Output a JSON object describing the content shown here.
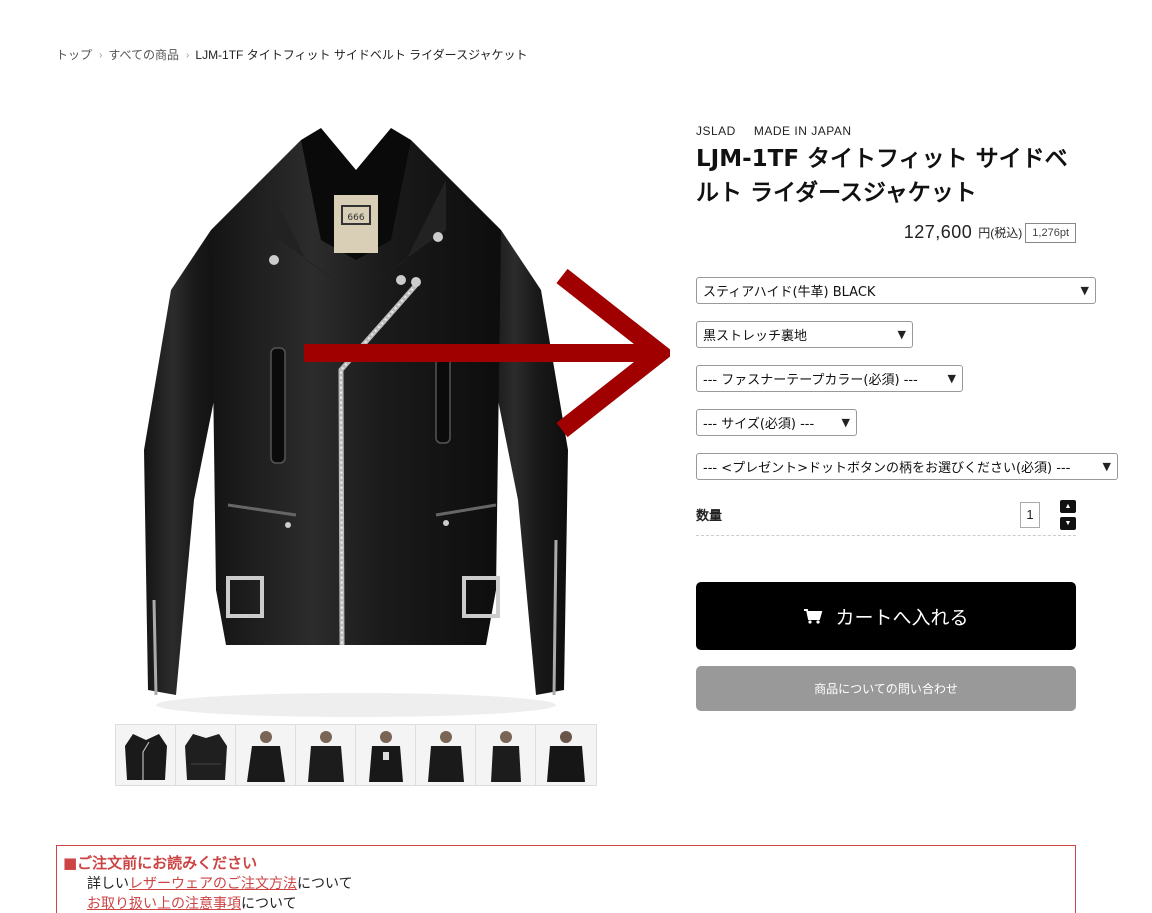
{
  "breadcrumb": {
    "items": [
      "トップ",
      "すべての商品"
    ],
    "current": "LJM-1TF タイトフィット サイドベルト ライダースジャケット",
    "separator": "›"
  },
  "product": {
    "brand": "JSLAD",
    "origin": "MADE IN JAPAN",
    "title": "LJM-1TF タイトフィット サイドベルト ライダースジャケット",
    "price": "127,600",
    "tax_label": "円(税込)",
    "points": "1,276pt"
  },
  "options": {
    "leather": "スティアハイド(牛革) BLACK",
    "lining": "黒ストレッチ裏地",
    "zipper_tape": "--- ファスナーテープカラー(必須) ---",
    "size": "--- サイズ(必須) ---",
    "present": "--- <プレゼント>ドットボタンの柄をお選びください(必須) ---"
  },
  "quantity": {
    "label": "数量",
    "value": "1"
  },
  "buttons": {
    "cart": "カートへ入れる",
    "inquiry": "商品についての問い合わせ"
  },
  "notice": {
    "title": "■ご注文前にお読みください",
    "line1_prefix": "詳しい",
    "line1_link": "レザーウェアのご注文方法",
    "line1_suffix": "について",
    "line2_link": "お取り扱い上の注意事項",
    "line2_suffix": "について"
  },
  "colors": {
    "accent_red": "#c44444",
    "arrow_red": "#a00000",
    "cart_bg": "#000000",
    "inquiry_bg": "#999999"
  },
  "icons": {
    "cart": "cart-icon",
    "chevron": "chevron-down-icon",
    "stepper_up": "caret-up-icon",
    "stepper_down": "caret-down-icon"
  }
}
